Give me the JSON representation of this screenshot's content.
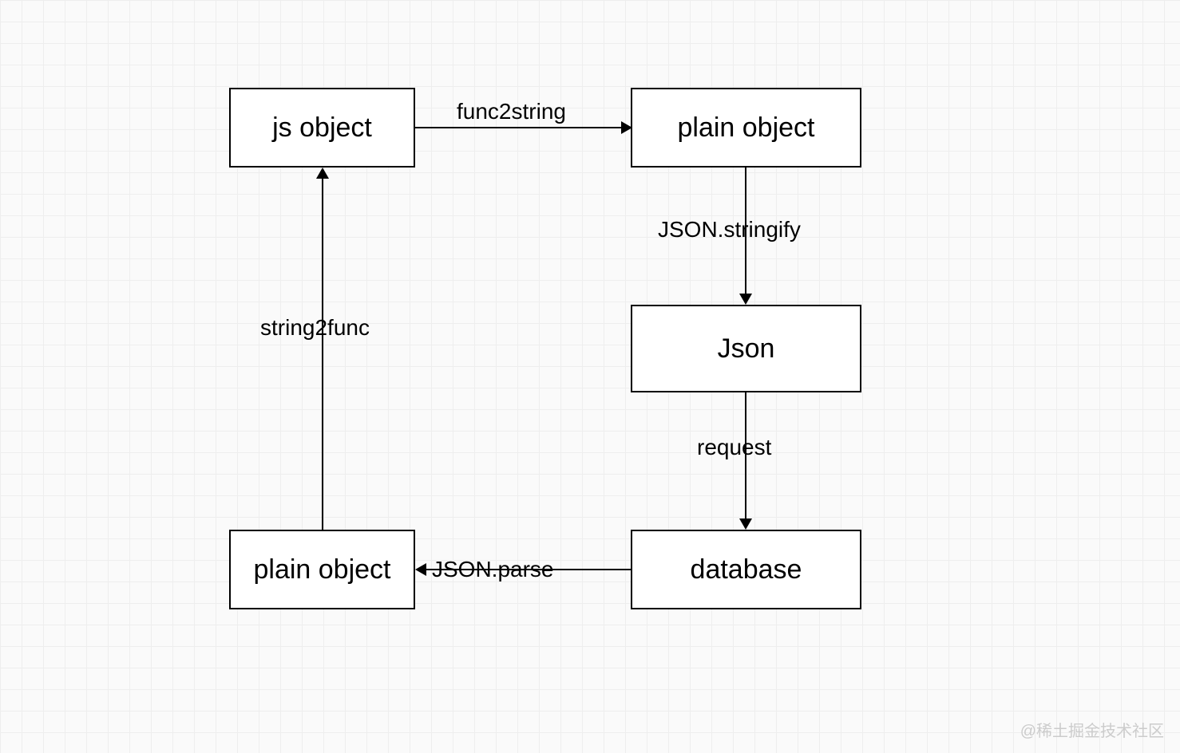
{
  "nodes": {
    "js_object": "js object",
    "plain_object_top": "plain object",
    "json": "Json",
    "database": "database",
    "plain_object_bottom": "plain object"
  },
  "edges": {
    "func2string": "func2string",
    "json_stringify": "JSON.stringify",
    "request": "request",
    "json_parse": "JSON.parse",
    "string2func": "string2func"
  },
  "watermark": "@稀土掘金技术社区"
}
